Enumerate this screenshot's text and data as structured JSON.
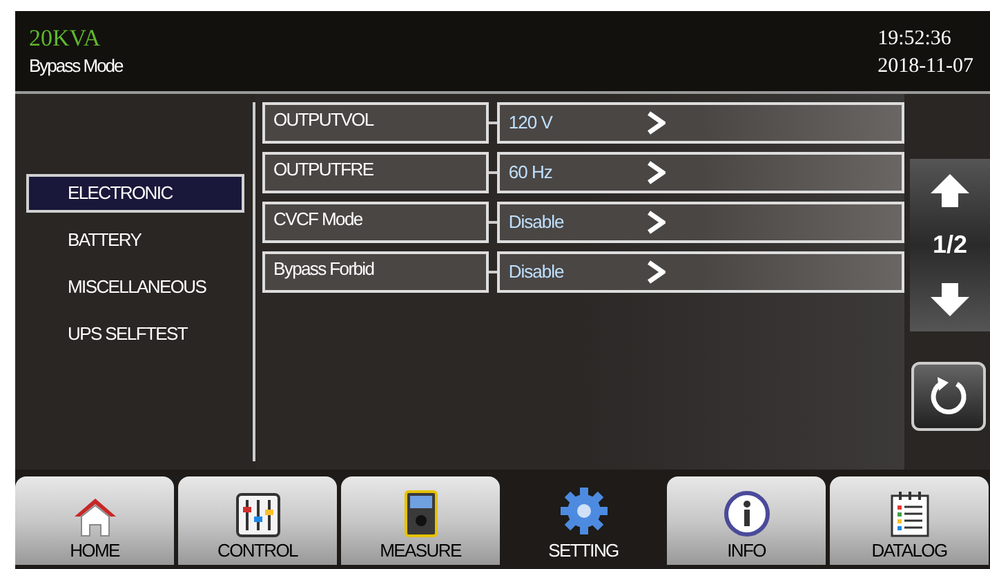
{
  "header": {
    "model": "20KVA",
    "mode": "Bypass Mode",
    "time": "19:52:36",
    "date": "2018-11-07"
  },
  "sidebar": {
    "items": [
      {
        "label": "ELECTRONIC",
        "selected": true
      },
      {
        "label": "BATTERY",
        "selected": false
      },
      {
        "label": "MISCELLANEOUS",
        "selected": false
      },
      {
        "label": "UPS SELFTEST",
        "selected": false
      }
    ]
  },
  "settings": [
    {
      "label": "OUTPUTVOL",
      "value": "120 V"
    },
    {
      "label": "OUTPUTFRE",
      "value": "60 Hz"
    },
    {
      "label": "CVCF Mode",
      "value": "Disable"
    },
    {
      "label": "Bypass Forbid",
      "value": "Disable"
    }
  ],
  "pager": {
    "page": "1/2"
  },
  "nav": [
    {
      "label": "HOME",
      "kind": "home",
      "selected": false
    },
    {
      "label": "CONTROL",
      "kind": "control",
      "selected": false
    },
    {
      "label": "MEASURE",
      "kind": "measure",
      "selected": false
    },
    {
      "label": "SETTING",
      "kind": "setting",
      "selected": true
    },
    {
      "label": "INFO",
      "kind": "info",
      "selected": false
    },
    {
      "label": "DATALOG",
      "kind": "datalog",
      "selected": false
    }
  ]
}
